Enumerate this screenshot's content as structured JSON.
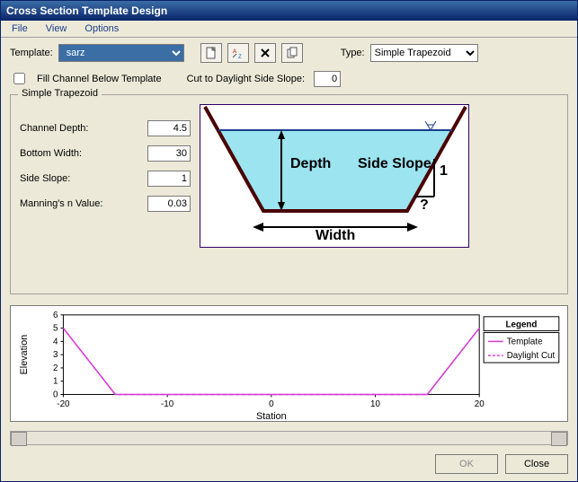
{
  "window": {
    "title": "Cross Section Template Design"
  },
  "menu": {
    "file": "File",
    "view": "View",
    "options": "Options"
  },
  "toolbar": {
    "template_label": "Template:",
    "template_value": "sarz",
    "type_label": "Type:",
    "type_value": "Simple Trapezoid",
    "icons": {
      "new": "new-page",
      "rename": "rename-az",
      "delete": "delete-x",
      "copy": "copy-pages"
    }
  },
  "options": {
    "fill_label": "Fill Channel Below Template",
    "fill_checked": false,
    "daylight_label": "Cut to Daylight Side Slope:",
    "daylight_value": "0"
  },
  "group": {
    "title": "Simple Trapezoid",
    "params": {
      "channel_depth": {
        "label": "Channel Depth:",
        "value": "4.5"
      },
      "bottom_width": {
        "label": "Bottom Width:",
        "value": "30"
      },
      "side_slope": {
        "label": "Side Slope:",
        "value": "1"
      },
      "mannings_n": {
        "label": "Manning's n Value:",
        "value": "0.03"
      }
    },
    "diagram": {
      "depth": "Depth",
      "side_slope": "Side Slope",
      "width": "Width",
      "one": "1",
      "q": "?"
    }
  },
  "chart_data": {
    "type": "line",
    "xlabel": "Station",
    "ylabel": "Elevation",
    "xlim": [
      -20,
      20
    ],
    "ylim": [
      0,
      6
    ],
    "xticks": [
      -20,
      -10,
      0,
      10,
      20
    ],
    "yticks": [
      0,
      1,
      2,
      3,
      4,
      5,
      6
    ],
    "legend_title": "Legend",
    "series": [
      {
        "name": "Template",
        "color": "#d63cd6",
        "style": "solid",
        "x": [
          -20,
          -15,
          15,
          20
        ],
        "y": [
          5,
          0,
          0,
          5
        ]
      },
      {
        "name": "Daylight Cut",
        "color": "#d63cd6",
        "style": "dash",
        "x": [
          -20,
          -15,
          15,
          20
        ],
        "y": [
          5,
          0,
          0,
          5
        ]
      }
    ]
  },
  "buttons": {
    "ok": "OK",
    "close": "Close"
  }
}
